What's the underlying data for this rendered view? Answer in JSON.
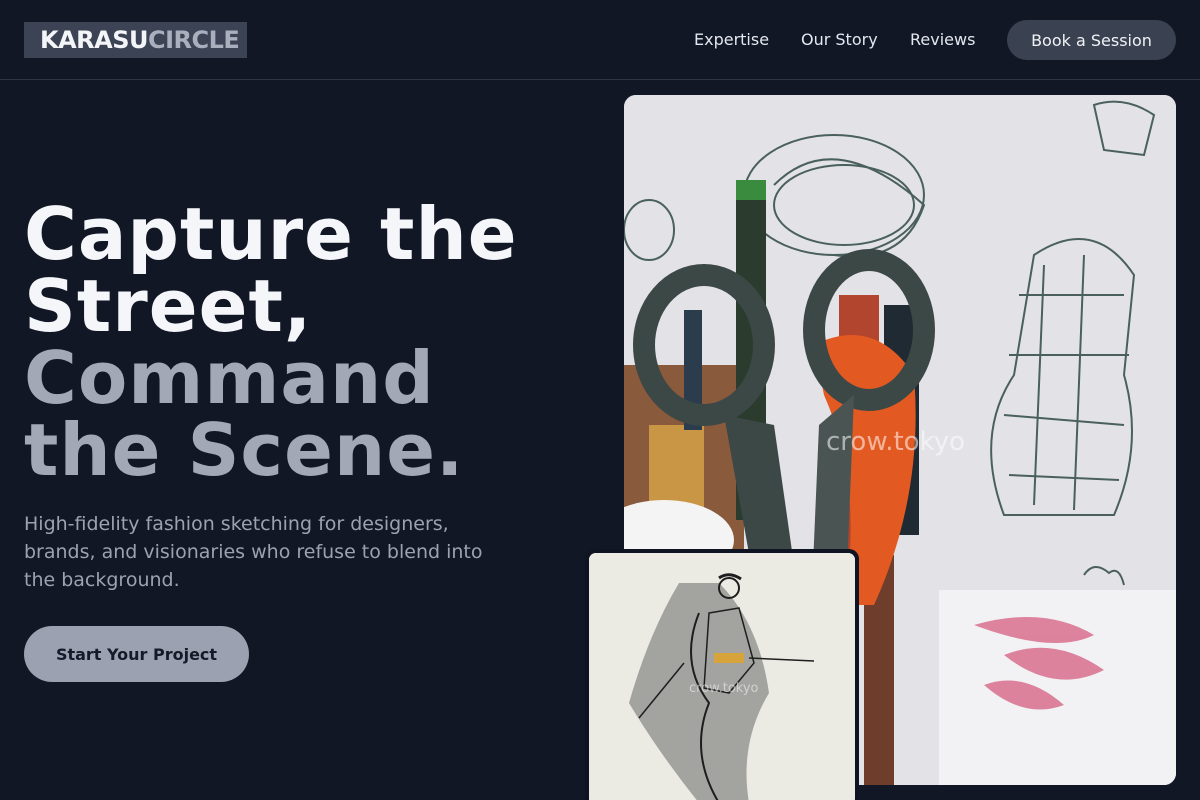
{
  "brand": {
    "part1": "KARASU",
    "part2": "CIRCLE"
  },
  "nav": {
    "links": [
      "Expertise",
      "Our Story",
      "Reviews"
    ],
    "cta": "Book a Session"
  },
  "hero": {
    "headline_line1": "Capture the",
    "headline_line2": "Street,",
    "headline_line3": "Command",
    "headline_line4": "the Scene.",
    "subtitle": "High-fidelity fashion sketching for designers, brands, and visionaries who refuse to blend into the background.",
    "cta": "Start Your Project"
  },
  "images": {
    "main_watermark": "crow.tokyo",
    "small_watermark": "crow.tokyo"
  },
  "colors": {
    "background": "#121726",
    "accent_button": "#9ba1b0",
    "nav_button": "#3a4251"
  }
}
